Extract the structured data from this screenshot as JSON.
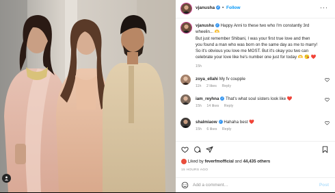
{
  "header": {
    "username": "vjanusha",
    "separator": "•",
    "follow_label": "Follow",
    "more_label": "···"
  },
  "caption": {
    "username": "vjanusha",
    "line1": "Happy Anni to these two who I'm constantly 3rd",
    "line2": "wheelin... 🫶",
    "line3": "But just remember Shibani, I was your first true love and then",
    "line4": "you found a man who was born on the same day as me to marry!",
    "line5": "So it's obvious you love me MOST. But it's okay you two can",
    "line6": "celebrate your love like he's number one just for today 🫶 😘 ❤️",
    "time": "15h"
  },
  "comments": [
    {
      "username": "zoya_ellahi",
      "text": "My fv coupple",
      "time": "11h",
      "likes": "2 likes",
      "reply": "Reply"
    },
    {
      "username": "iam_reyhna",
      "text": "That's what soul sisters look like ❤️",
      "time": "15h",
      "likes": "14 likes",
      "reply": "Reply"
    },
    {
      "username": "shalmiaow",
      "text": "Hahaha best ❤️",
      "time": "15h",
      "likes": "6 likes",
      "reply": "Reply"
    }
  ],
  "likes": {
    "prefix": "Liked by",
    "user": "feverfmofficial",
    "middle": "and",
    "others": "44,435 others"
  },
  "time_ago": "15 HOURS AGO",
  "add_comment": {
    "placeholder": "Add a comment…",
    "post_label": "Post"
  },
  "icons": {
    "like": "heart-icon",
    "comment": "comment-icon",
    "share": "share-icon",
    "save": "bookmark-icon",
    "emoji": "emoji-icon",
    "tag": "user-tag-icon"
  },
  "colors": {
    "link": "#0095f6",
    "verified": "#3897f0",
    "muted": "#8e8e8e",
    "heart": "#ed4956",
    "post_disabled": "#b2dffc"
  }
}
